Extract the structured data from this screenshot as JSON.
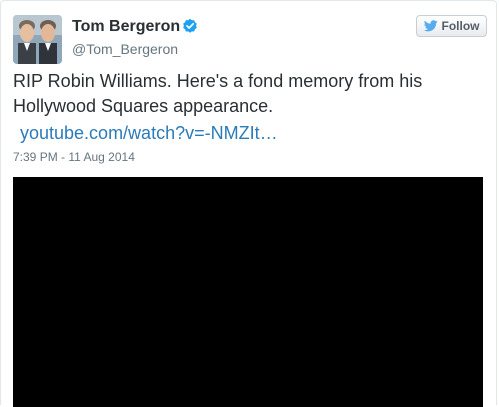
{
  "author": {
    "name": "Tom Bergeron",
    "handle": "@Tom_Bergeron",
    "verified_icon": "verified-badge-icon"
  },
  "follow_button": {
    "label": "Follow",
    "icon": "bird-icon"
  },
  "tweet": {
    "text": "RIP Robin Williams.  Here's a fond memory from his\nHollywood Squares appearance.",
    "link": "youtube.com/watch?v=-NMZIt…",
    "timestamp": "7:39 PM - 11 Aug 2014"
  },
  "colors": {
    "link": "#2b7bb9",
    "verified": "#1da1f2",
    "text": "#292f33",
    "muted": "#66757f",
    "video_background": "#000000"
  }
}
